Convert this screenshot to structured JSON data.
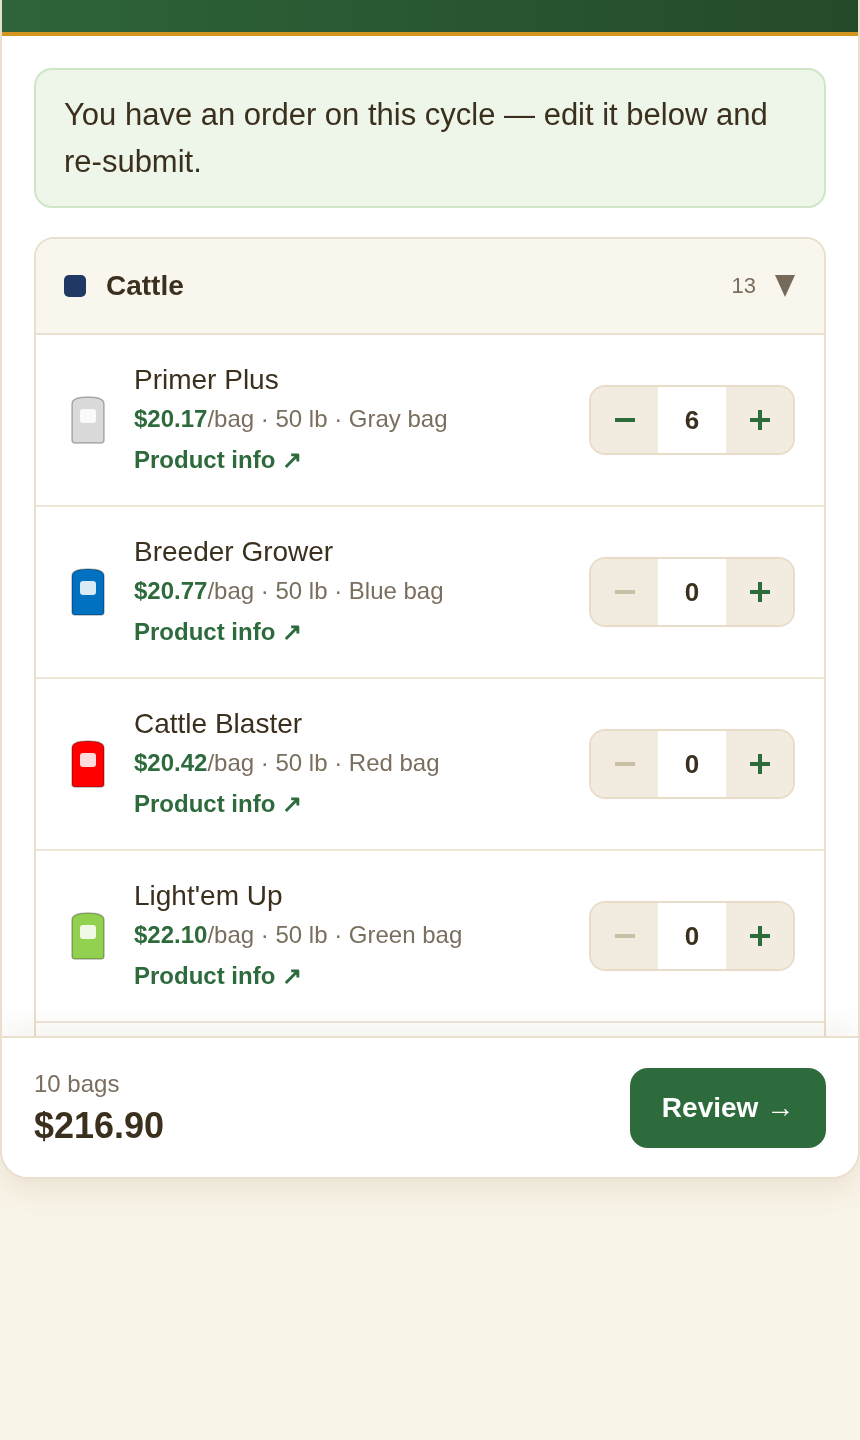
{
  "notice": {
    "text": "You have an order on this cycle — edit it below and re-submit."
  },
  "category": {
    "name": "Cattle",
    "color": "#1f3864",
    "count": "13",
    "expanded": true,
    "products": [
      {
        "name": "Primer Plus",
        "meta": "**$20.17**/bag · 50 lb · Gray bag",
        "link": "Product info ↗",
        "color": "#d9d9d9",
        "quantity": "6",
        "decrease_disabled": false
      },
      {
        "name": "Breeder Grower",
        "meta": "**$20.77**/bag · 50 lb · Blue bag",
        "link": "Product info ↗",
        "color": "#0070c0",
        "quantity": "0",
        "decrease_disabled": true
      },
      {
        "name": "Cattle Blaster",
        "meta": "**$20.42**/bag · 50 lb · Red bag",
        "link": "Product info ↗",
        "color": "#ff0000",
        "quantity": "0",
        "decrease_disabled": true
      },
      {
        "name": "Light'em Up",
        "meta": "**$22.10**/bag · 50 lb · Green bag",
        "link": "Product info ↗",
        "color": "#92d050",
        "quantity": "0",
        "decrease_disabled": true
      }
    ]
  },
  "footer": {
    "bag_count": "10 bags",
    "total": "$216.90",
    "button": "Review →"
  }
}
